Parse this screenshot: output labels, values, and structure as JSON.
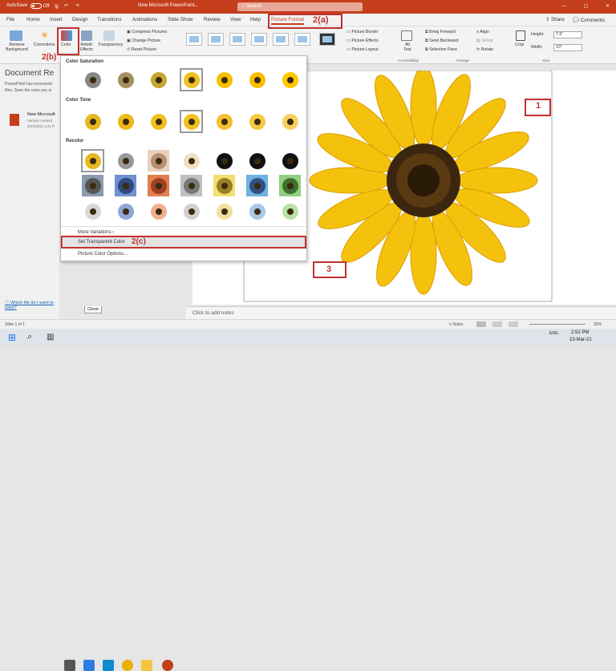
{
  "titlebar": {
    "autosave_label": "AutoSave",
    "autosave_state": "Off",
    "doc_title": "New Microsoft PowerPoint...",
    "search_placeholder": "Search"
  },
  "tabs": [
    "File",
    "Home",
    "Insert",
    "Design",
    "Transitions",
    "Animations",
    "Slide Show",
    "Review",
    "View",
    "Help",
    "Picture Format"
  ],
  "tabs_right": {
    "share": "Share",
    "comments": "Comments"
  },
  "ribbon": {
    "remove_background": "Remove Background",
    "corrections": "Corrections",
    "color": "Color",
    "artistic_effects": "Artistic Effects",
    "transparency": "Transparency",
    "compress": "Compress Pictures",
    "change": "Change Picture",
    "reset": "Reset Picture",
    "border": "Picture Border",
    "effects": "Picture Effects",
    "layout": "Picture Layout",
    "alt_text": "Alt Text",
    "bring_forward": "Bring Forward",
    "send_backward": "Send Backward",
    "selection_pane": "Selection Pane",
    "align": "Align",
    "group": "Group",
    "rotate": "Rotate",
    "crop": "Crop",
    "height_label": "Height:",
    "height_value": "7.5\"",
    "width_label": "Width:",
    "width_value": "10\"",
    "group_accessibility": "Accessibility",
    "group_arrange": "Arrange",
    "group_size": "Size"
  },
  "leftpane": {
    "heading": "Document Re",
    "text1": "PowerPoint has recovered",
    "text2": "files. Save the ones you w",
    "file_name": "New Microsoft",
    "file_meta1": "Version created",
    "file_meta2": "3/13/2021 3:41 P",
    "help_link": "Which file do I want to save?",
    "close_button": "Close"
  },
  "dropdown": {
    "color_saturation": "Color Saturation",
    "color_tone": "Color Tone",
    "recolor": "Recolor",
    "more_variations": "More Variations",
    "set_transparent": "Set Transparent Color",
    "picture_color_options": "Picture Color Options..."
  },
  "annotations": {
    "a": "2(a)",
    "b": "2(b)",
    "c": "2(c)",
    "one": "1",
    "three": "3"
  },
  "notes_placeholder": "Click to add notes",
  "statusbar": {
    "slide": "Slide 1 of 1",
    "notes": "Notes",
    "zoom": "30%"
  },
  "taskbar": {
    "time": "2:52 PM",
    "date": "13-Mar-21",
    "lang": "ENG"
  },
  "colors": {
    "brand": "#c43e1c",
    "annotation": "#c03030"
  }
}
